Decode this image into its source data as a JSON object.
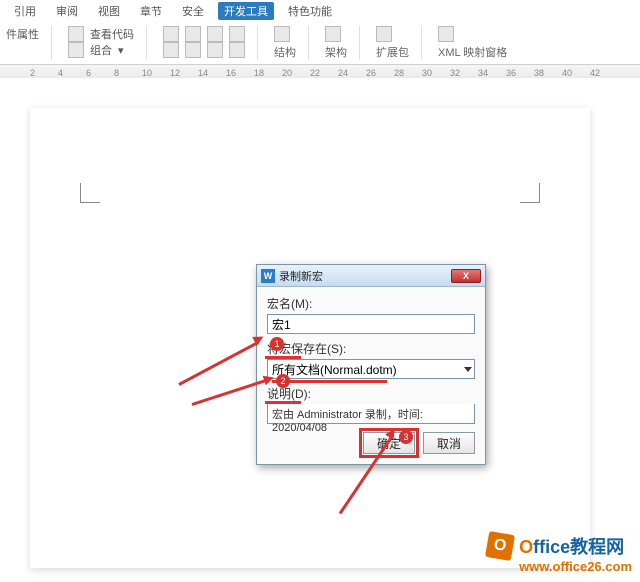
{
  "menu": {
    "tabs": [
      "引用",
      "审阅",
      "视图",
      "章节",
      "安全"
    ],
    "active": "开发工具",
    "extra": "特色功能"
  },
  "ribbon": {
    "group1": {
      "a": "查看代码",
      "b": "组合"
    },
    "group2_label": "结构",
    "group3_label": "架构",
    "group4_label": "扩展包",
    "group5_label": "XML 映射窗格"
  },
  "ruler_ticks": [
    "2",
    "4",
    "6",
    "8",
    "10",
    "12",
    "14",
    "16",
    "18",
    "20",
    "22",
    "24",
    "26",
    "28",
    "30",
    "32",
    "34",
    "36",
    "38",
    "40",
    "42"
  ],
  "dialog": {
    "title": "录制新宏",
    "close": "X",
    "macro_name_label": "宏名(M):",
    "macro_name": "宏1",
    "save_in_label": "将宏保存在(S):",
    "save_in_value": "所有文档(Normal.dotm)",
    "desc_label": "说明(D):",
    "desc_value": "宏由 Administrator 录制，时间: 2020/04/08",
    "ok": "确定",
    "cancel": "取消"
  },
  "annotations": {
    "c1": "1",
    "c2": "2",
    "c3": "3"
  },
  "watermark": {
    "brand_o": "O",
    "brand_rest": "ffice教程网",
    "url": "www.office26.com"
  },
  "attrs_label": "件属性"
}
